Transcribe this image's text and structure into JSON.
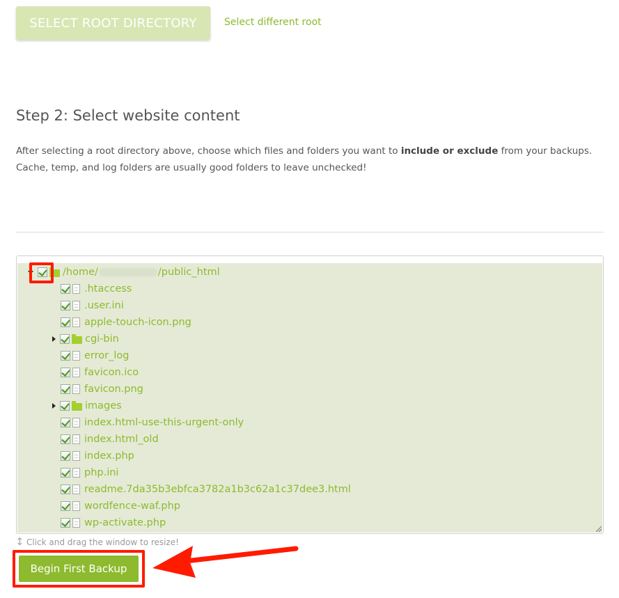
{
  "root_selector": {
    "button_label": "SELECT ROOT DIRECTORY",
    "link_label": "Select different root"
  },
  "step2": {
    "title": "Step 2: Select website content",
    "desc_before": "After selecting a root directory above, choose which files and folders you want to ",
    "desc_bold": "include or exclude",
    "desc_after": " from your backups. Cache, temp, and log folders are usually good folders to leave unchecked!"
  },
  "tree": {
    "root_prefix": "/home/",
    "root_suffix": "/public_html",
    "items": [
      {
        "label": ".htaccess",
        "type": "file"
      },
      {
        "label": ".user.ini",
        "type": "file"
      },
      {
        "label": "apple-touch-icon.png",
        "type": "file"
      },
      {
        "label": "cgi-bin",
        "type": "folder"
      },
      {
        "label": "error_log",
        "type": "file"
      },
      {
        "label": "favicon.ico",
        "type": "file"
      },
      {
        "label": "favicon.png",
        "type": "file"
      },
      {
        "label": "images",
        "type": "folder"
      },
      {
        "label": "index.html-use-this-urgent-only",
        "type": "file"
      },
      {
        "label": "index.html_old",
        "type": "file"
      },
      {
        "label": "index.php",
        "type": "file"
      },
      {
        "label": "php.ini",
        "type": "file"
      },
      {
        "label": "readme.7da35b3ebfca3782a1b3c62a1c37dee3.html",
        "type": "file"
      },
      {
        "label": "wordfence-waf.php",
        "type": "file"
      },
      {
        "label": "wp-activate.php",
        "type": "file"
      }
    ]
  },
  "resize_hint": "Click and drag the window to resize!",
  "begin_button": "Begin First Backup",
  "colors": {
    "accent_green": "#8dba2e",
    "annotation_red": "#ff1b00",
    "tree_bg": "#e5ead6"
  },
  "icons": [
    "checkbox-checked-icon",
    "file-icon",
    "folder-icon",
    "expand-arrow-icon",
    "resize-icon",
    "annotation-arrow-icon"
  ]
}
